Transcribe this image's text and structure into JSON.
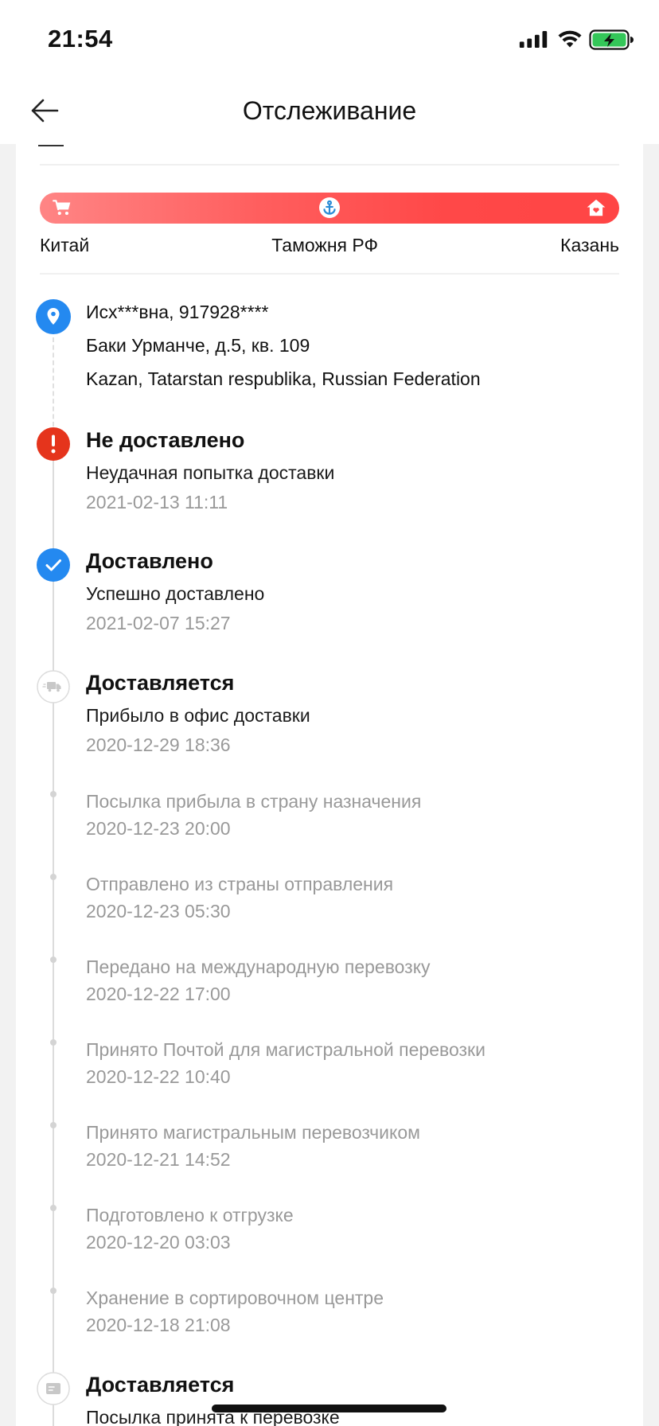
{
  "status_bar": {
    "time": "21:54",
    "icons": [
      "cellular-signal-icon",
      "wifi-icon",
      "battery-charging-icon"
    ]
  },
  "header": {
    "title": "Отслеживание",
    "back_icon": "arrow-left-icon"
  },
  "route": {
    "stages": [
      {
        "label": "Китай",
        "icon": "cart-icon"
      },
      {
        "label": "Таможня РФ",
        "icon": "anchor-icon"
      },
      {
        "label": "Казань",
        "icon": "home-icon"
      }
    ]
  },
  "address": {
    "icon": "location-pin-icon",
    "recipient": "Исх***вна, 917928****",
    "street": "Баки Урманче, д.5, кв. 109",
    "city": "Kazan, Tatarstan respublika, Russian Federation"
  },
  "events": [
    {
      "status": "Не доставлено",
      "description": "Неудачная попытка доставки",
      "datetime": "2021-02-13 11:11",
      "icon": "exclamation-icon"
    },
    {
      "status": "Доставлено",
      "description": "Успешно доставлено",
      "datetime": "2021-02-07 15:27",
      "icon": "check-icon"
    },
    {
      "status": "Доставляется",
      "description": "Прибыло в офис доставки",
      "datetime": "2020-12-29 18:36",
      "icon": "truck-icon"
    },
    {
      "description": "Посылка прибыла в страну назначения",
      "datetime": "2020-12-23 20:00"
    },
    {
      "description": "Отправлено из страны отправления",
      "datetime": "2020-12-23 05:30"
    },
    {
      "description": "Передано на международную перевозку",
      "datetime": "2020-12-22 17:00"
    },
    {
      "description": "Принято Почтой для магистральной перевозки",
      "datetime": "2020-12-22 10:40"
    },
    {
      "description": "Принято магистральным перевозчиком",
      "datetime": "2020-12-21 14:52"
    },
    {
      "description": "Подготовлено к отгрузке",
      "datetime": "2020-12-20 03:03"
    },
    {
      "description": "Хранение в сортировочном центре",
      "datetime": "2020-12-18 21:08"
    },
    {
      "status": "Доставляется",
      "description": "Посылка принята к перевозке",
      "icon": "parcel-icon"
    }
  ],
  "colors": {
    "blue": "#2489f0",
    "error_red": "#e5341c",
    "accent_red": "#ff4b4b",
    "muted_text": "#999999",
    "timeline_line": "#dcdcdc"
  }
}
